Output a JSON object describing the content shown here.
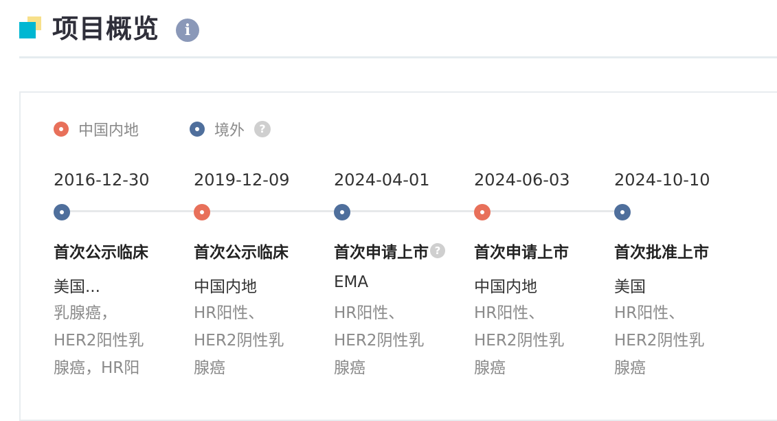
{
  "header": {
    "title": "项目概览",
    "info_icon": "info-icon"
  },
  "colors": {
    "domestic": "#e8705a",
    "overseas": "#4f6f9c",
    "accent_cyan": "#00b7d2",
    "accent_yellow": "#f7e08a"
  },
  "legend": {
    "domestic_label": "中国内地",
    "overseas_label": "境外",
    "help_icon": "question-circle-icon"
  },
  "events": [
    {
      "date": "2016-12-30",
      "region_type": "overseas",
      "stage": "首次公示临床",
      "region": "美国...",
      "indication": "乳腺癌，HER2阳性乳腺癌，HR阳"
    },
    {
      "date": "2019-12-09",
      "region_type": "domestic",
      "stage": "首次公示临床",
      "region": "中国内地",
      "indication": "HR阳性、HER2阴性乳腺癌"
    },
    {
      "date": "2024-04-01",
      "region_type": "overseas",
      "stage": "首次申请上市",
      "region": "EMA",
      "indication": "HR阳性、HER2阴性乳腺癌",
      "has_help": true
    },
    {
      "date": "2024-06-03",
      "region_type": "domestic",
      "stage": "首次申请上市",
      "region": "中国内地",
      "indication": "HR阳性、HER2阴性乳腺癌"
    },
    {
      "date": "2024-10-10",
      "region_type": "overseas",
      "stage": "首次批准上市",
      "region": "美国",
      "indication": "HR阳性、HER2阴性乳腺癌"
    }
  ]
}
